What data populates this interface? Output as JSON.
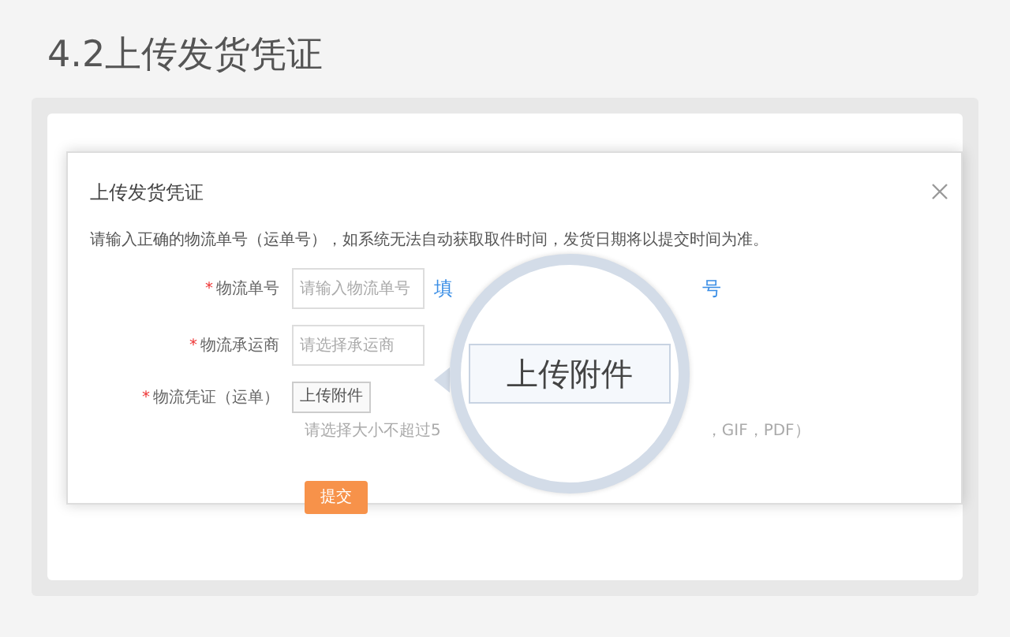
{
  "heading": "4.2上传发货凭证",
  "dialog": {
    "title": "上传发货凭证",
    "instruction": "请输入正确的物流单号（运单号），如系统无法自动获取取件时间，发货日期将以提交时间为准。",
    "fields": [
      {
        "kind": "input",
        "mark": "*",
        "label": "物流单号",
        "placeholder": "请输入物流单号",
        "link_start": "填",
        "link_end": "号"
      },
      {
        "kind": "input",
        "mark": "*",
        "label": "物流承运商",
        "placeholder": "请选择承运商"
      },
      {
        "kind": "upload",
        "mark": "*",
        "label": "物流凭证（运单）",
        "button": "上传附件",
        "hint_start": "请选择大小不超过5",
        "hint_end": "，GIF，PDF）"
      }
    ],
    "submit": "提交"
  },
  "magnifier": {
    "button": "上传附件"
  }
}
